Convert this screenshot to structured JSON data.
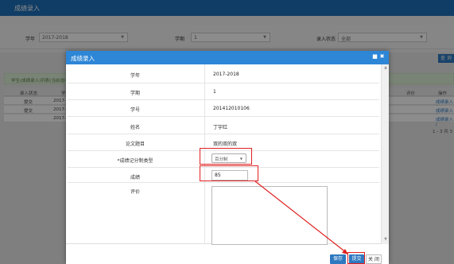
{
  "page": {
    "title": "成绩录入",
    "filters": [
      {
        "label": "学年",
        "value": "2017-2018"
      },
      {
        "label": "学期",
        "value": "1"
      },
      {
        "label": "录入状态",
        "value": "全部"
      }
    ],
    "query_button": "查 询",
    "notice": "学生(成绩录入)列表(当前选中",
    "table_headers": [
      "录入状态",
      "学号",
      "评价",
      "操作"
    ],
    "rows": [
      {
        "status": "提交",
        "id": "2017-1",
        "action": "成绩录入 /"
      },
      {
        "status": "提交",
        "id": "2017-1",
        "action": "成绩录入 /"
      },
      {
        "status": "",
        "id": "2017-1",
        "action": "成绩录入 /"
      }
    ],
    "pager": "1 - 3   共 3"
  },
  "modal": {
    "title": "成绩录入",
    "fields": [
      {
        "label": "学年",
        "value": "2017-2018"
      },
      {
        "label": "学期",
        "value": "1"
      },
      {
        "label": "学号",
        "value": "201412010106"
      },
      {
        "label": "姓名",
        "value": "丁宇红"
      },
      {
        "label": "论文题目",
        "value": "双的双的双"
      }
    ],
    "grade_type": {
      "label": "*成绩记分制类型",
      "value": "百分制"
    },
    "score": {
      "label": "成绩",
      "value": "85"
    },
    "comment": {
      "label": "评价",
      "value": ""
    },
    "buttons": {
      "save": "保存",
      "submit": "提交",
      "close": "关 闭"
    }
  },
  "colors": {
    "header": "#2e86d6",
    "topbar": "#1e6fb8",
    "button": "#2d78c0",
    "annotation": "#e02020"
  }
}
